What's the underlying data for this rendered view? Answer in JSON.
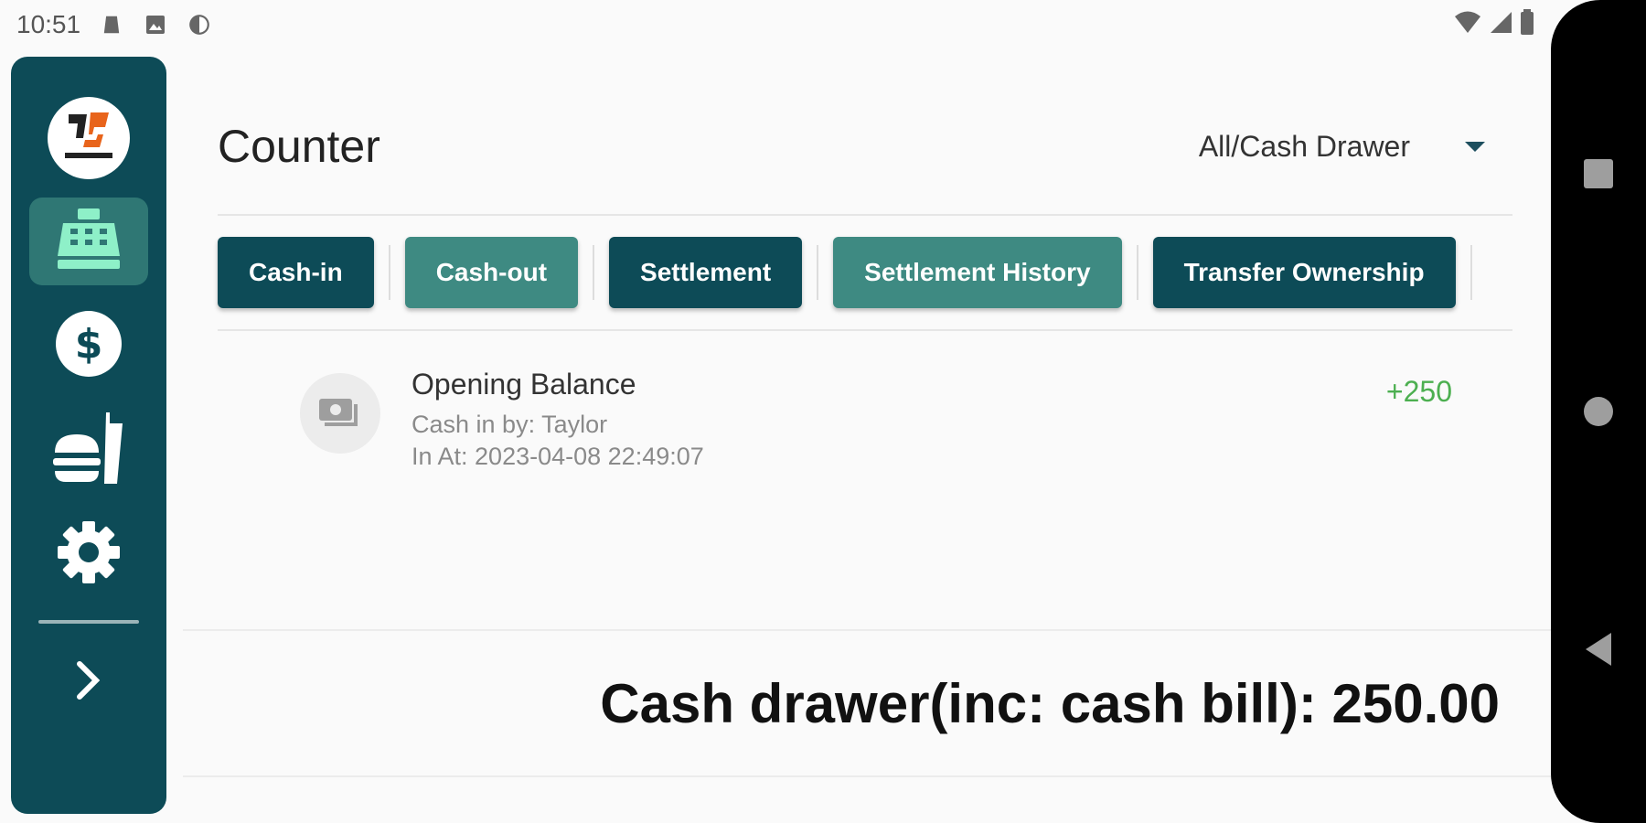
{
  "status_bar": {
    "time": "10:51",
    "icons": [
      "notification-icon",
      "image-icon",
      "app-icon"
    ],
    "right_icons": [
      "wifi-icon",
      "signal-icon",
      "battery-icon"
    ]
  },
  "sidebar": {
    "logo": "app-logo",
    "items": [
      {
        "name": "cash-register",
        "icon": "cash-register-icon",
        "active": true
      },
      {
        "name": "payments",
        "icon": "dollar-icon",
        "active": false
      },
      {
        "name": "menu",
        "icon": "food-icon",
        "active": false
      },
      {
        "name": "settings",
        "icon": "gear-icon",
        "active": false
      }
    ],
    "expand_icon": "chevron-right-icon"
  },
  "header": {
    "title": "Counter",
    "drawer_select": "All/Cash Drawer"
  },
  "actions": [
    {
      "label": "Cash-in",
      "style": "dark"
    },
    {
      "label": "Cash-out",
      "style": "light"
    },
    {
      "label": "Settlement",
      "style": "dark"
    },
    {
      "label": "Settlement History",
      "style": "light"
    },
    {
      "label": "Transfer Ownership",
      "style": "dark"
    }
  ],
  "entries": [
    {
      "title": "Opening Balance",
      "by": "Cash in by: Taylor",
      "at": "In At: 2023-04-08 22:49:07",
      "amount": "+250"
    }
  ],
  "footer": {
    "total": "Cash drawer(inc: cash bill): 250.00"
  },
  "colors": {
    "primary": "#0d4b57",
    "secondary": "#3e8a82",
    "positive": "#4caf50"
  }
}
